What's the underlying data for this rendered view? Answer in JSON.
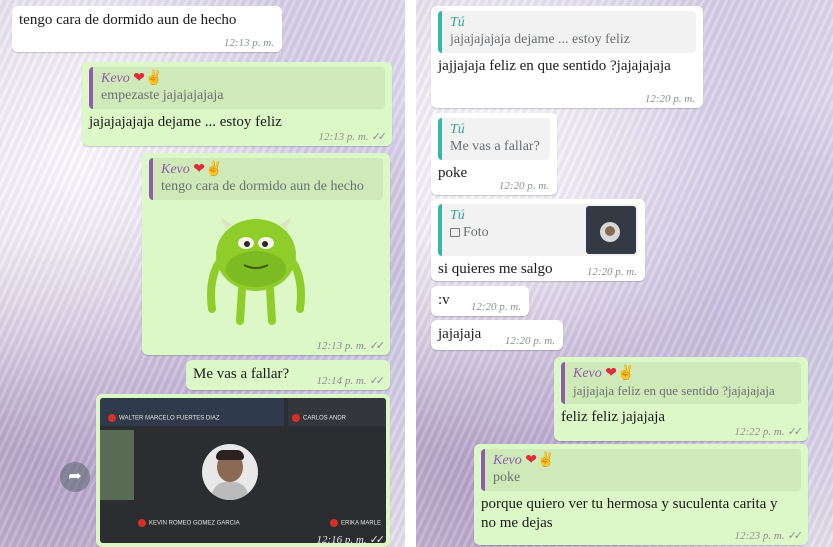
{
  "left": {
    "messages": [
      {
        "text": "tengo cara de dormido aun de hecho",
        "time": "12:13 p. m."
      },
      {
        "quote_author": "Kevo",
        "quote_text": "empezaste jajajajajaja",
        "text": "jajajajajaja dejame ... estoy feliz",
        "time": "12:13 p. m.",
        "ticks": "✓✓"
      },
      {
        "quote_author": "Kevo",
        "quote_text": "tengo cara de dormido aun de hecho",
        "time": "12:13 p. m.",
        "ticks": "✓✓",
        "sticker": "mike-wazowski-sticker"
      },
      {
        "text": "Me vas a fallar?",
        "time": "12:14 p. m.",
        "ticks": "✓✓"
      },
      {
        "time": "12:16 p. m.",
        "ticks": "✓✓",
        "video_call": {
          "participants": [
            "WALTER MARCELO FUERTES DIAZ",
            "CARLOS ANDR",
            "KEVIN ROMEO GOMEZ GARCIA",
            "ERIKA MARLE"
          ]
        }
      }
    ],
    "forward_icon": "forward-arrow-icon"
  },
  "right": {
    "messages": [
      {
        "quote_author": "Tú",
        "quote_text": "jajajajajaja dejame ... estoy feliz",
        "text": "jajjajaja feliz en que sentido ?jajajajaja",
        "time": "12:20 p. m."
      },
      {
        "quote_author": "Tú",
        "quote_text": "Me vas a fallar?",
        "text": "poke",
        "time": "12:20 p. m."
      },
      {
        "quote_author": "Tú",
        "quote_text": "Foto",
        "text": "si quieres me salgo",
        "time": "12:20 p. m."
      },
      {
        "text": ":v",
        "time": "12:20 p. m."
      },
      {
        "text": "jajajaja",
        "time": "12:20 p. m."
      },
      {
        "quote_author": "Kevo",
        "quote_text": "jajjajaja feliz en que sentido ?jajajajaja",
        "text": "feliz feliz jajajaja",
        "time": "12:22 p. m.",
        "ticks": "✓✓"
      },
      {
        "quote_author": "Kevo",
        "quote_text": "poke",
        "text": "porque quiero ver tu hermosa y suculenta carita y no me dejas",
        "time": "12:23 p. m.",
        "ticks": "✓✓"
      }
    ]
  },
  "colors": {
    "incoming": "#ffffff",
    "outgoing": "#dcf8c6",
    "quote_purple": "#8e5ca8",
    "quote_teal": "#35b7a5",
    "heart": "#e02a3a"
  }
}
